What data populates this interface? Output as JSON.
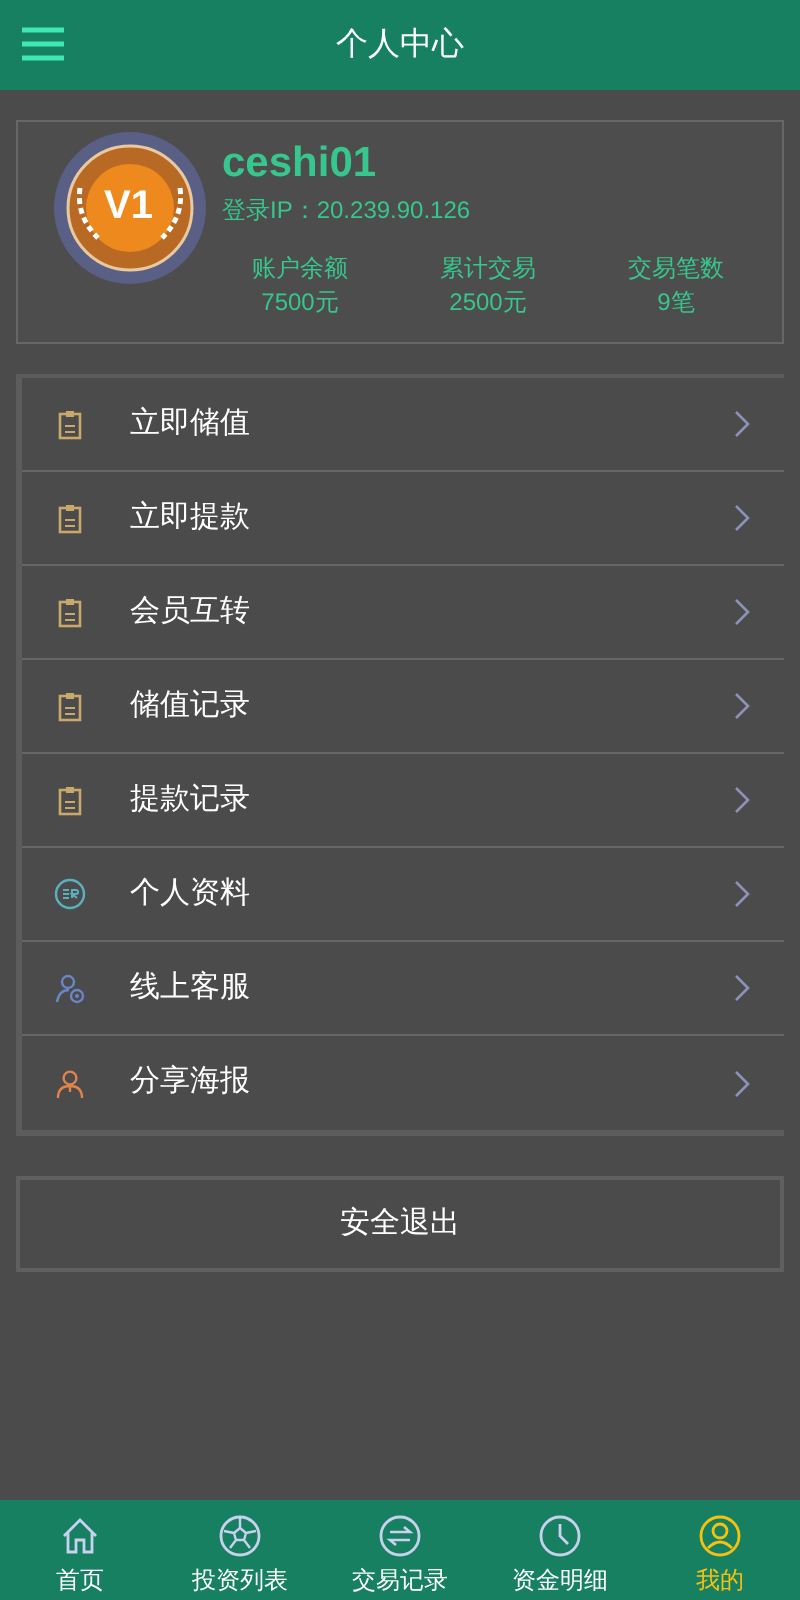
{
  "header": {
    "title": "个人中心"
  },
  "profile": {
    "badge": "V1",
    "username": "ceshi01",
    "login_ip": "登录IP：20.239.90.126",
    "stats": [
      {
        "label": "账户余额",
        "value": "7500元"
      },
      {
        "label": "累计交易",
        "value": "2500元"
      },
      {
        "label": "交易笔数",
        "value": "9笔"
      }
    ]
  },
  "menu": [
    {
      "label": "立即储值",
      "kind": "clipboard"
    },
    {
      "label": "立即提款",
      "kind": "clipboard"
    },
    {
      "label": "会员互转",
      "kind": "clipboard"
    },
    {
      "label": "储值记录",
      "kind": "clipboard"
    },
    {
      "label": "提款记录",
      "kind": "clipboard"
    },
    {
      "label": "个人资料",
      "kind": "profile"
    },
    {
      "label": "线上客服",
      "kind": "service"
    },
    {
      "label": "分享海报",
      "kind": "share"
    }
  ],
  "logout_button": "安全退出",
  "tab_bar": [
    {
      "label": "首页",
      "kind": "home",
      "selected": false
    },
    {
      "label": "投资列表",
      "kind": "ball",
      "selected": false
    },
    {
      "label": "交易记录",
      "kind": "exchange",
      "selected": false
    },
    {
      "label": "资金明细",
      "kind": "clock",
      "selected": false
    },
    {
      "label": "我的",
      "kind": "user",
      "selected": true
    }
  ]
}
